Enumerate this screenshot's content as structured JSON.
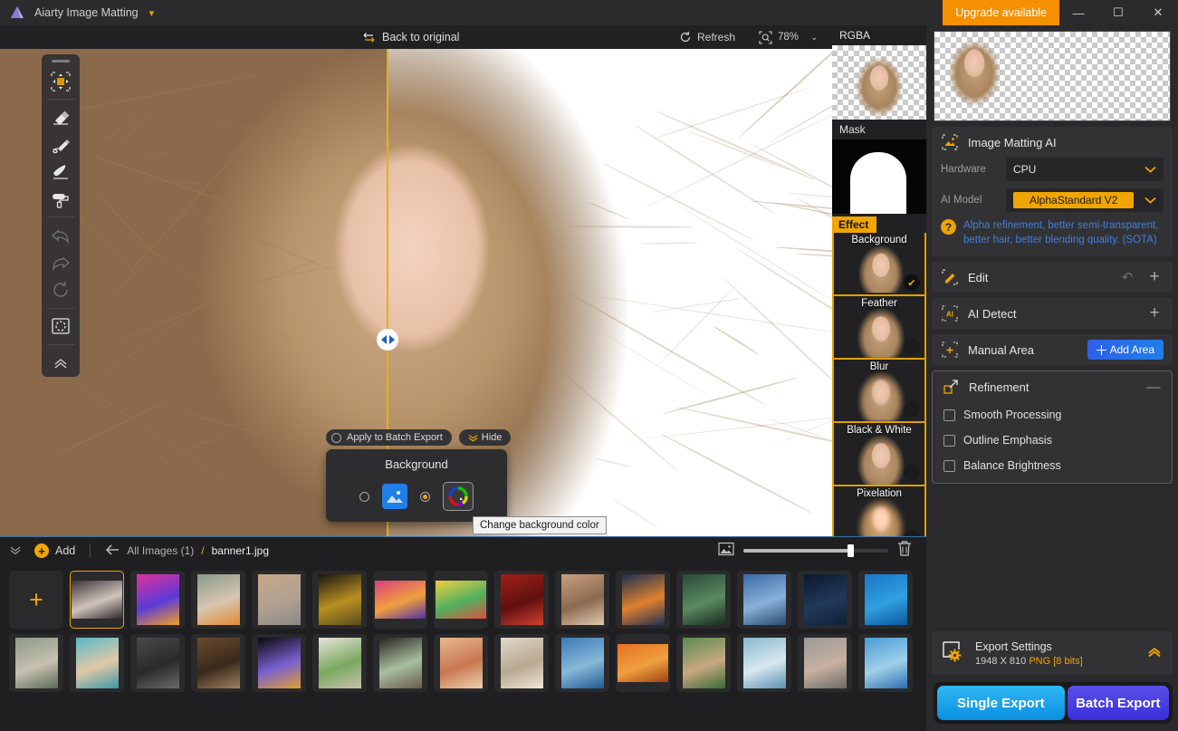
{
  "titlebar": {
    "app_name": "Aiarty Image Matting",
    "caret_icon": "chevron-down-icon",
    "upgrade_label": "Upgrade available",
    "minimize": "—",
    "maximize": "☐",
    "close": "✕"
  },
  "toolbar": {
    "back_to_original": "Back to original",
    "refresh": "Refresh",
    "zoom_level": "78%",
    "zoom_caret": "⌄"
  },
  "tools": [
    {
      "name": "move-tool",
      "glyph": "✥",
      "active": true,
      "dim": false
    },
    {
      "name": "eraser-tool",
      "glyph": "▱",
      "active": false,
      "dim": false
    },
    {
      "name": "pen-tool",
      "glyph": "✎",
      "active": false,
      "dim": false
    },
    {
      "name": "brush-tool",
      "glyph": "✒",
      "active": false,
      "dim": false
    },
    {
      "name": "roller-tool",
      "glyph": "▬",
      "active": false,
      "dim": false
    },
    {
      "name": "undo-tool",
      "glyph": "↶",
      "active": false,
      "dim": true
    },
    {
      "name": "redo-tool",
      "glyph": "↷",
      "active": false,
      "dim": true
    },
    {
      "name": "reset-tool",
      "glyph": "↺",
      "active": false,
      "dim": true
    },
    {
      "name": "selection-tool",
      "glyph": "◌",
      "active": false,
      "dim": false
    },
    {
      "name": "collapse-rail",
      "glyph": "⌃",
      "active": false,
      "dim": false
    }
  ],
  "background_popup": {
    "apply_batch_label": "Apply to Batch Export",
    "hide_label": "Hide",
    "hide_icon": "chevron-double-down-icon",
    "card_title": "Background",
    "option_image": "image-swatch",
    "option_color": "color-wheel-swatch",
    "selected": "color",
    "tooltip": "Change background color"
  },
  "strip": {
    "rgba_label": "RGBA",
    "mask_label": "Mask",
    "effect_label": "Effect",
    "effects": [
      {
        "name": "Background",
        "selected": true
      },
      {
        "name": "Feather",
        "selected": false
      },
      {
        "name": "Blur",
        "selected": false
      },
      {
        "name": "Black & White",
        "selected": false
      },
      {
        "name": "Pixelation",
        "selected": false
      }
    ],
    "check_glyph": "✔"
  },
  "right_panel": {
    "matting": {
      "icon": "image-matting-icon",
      "title": "Image Matting AI",
      "hardware_label": "Hardware",
      "hardware_value": "CPU",
      "ai_model_label": "AI Model",
      "ai_model_value": "AlphaStandard  V2",
      "note": "Alpha refinement, better semi-transparent, better hair, better blending quality. (SOTA)",
      "note_color": "#3f7fe0",
      "help_glyph": "?"
    },
    "edit": {
      "icon": "edit-pencil-icon",
      "title": "Edit",
      "undo_glyph": "↶",
      "add_glyph": "+"
    },
    "ai_detect": {
      "icon": "ai-detect-icon",
      "title": "AI Detect",
      "add_glyph": "+"
    },
    "manual_area": {
      "icon": "manual-area-icon",
      "title": "Manual Area",
      "button_label": "Add Area",
      "button_icon": "crosshair-icon"
    },
    "refinement": {
      "icon": "refinement-icon",
      "title": "Refinement",
      "collapse_glyph": "—",
      "options": [
        {
          "label": "Smooth Processing",
          "checked": false
        },
        {
          "label": "Outline Emphasis",
          "checked": false
        },
        {
          "label": "Balance Brightness",
          "checked": false
        }
      ]
    },
    "export_settings": {
      "icon": "export-settings-icon",
      "title": "Export Settings",
      "dimensions": "1948 X 810",
      "format": "PNG",
      "bitdepth": "[8 bits]",
      "chevron": "⌃"
    },
    "single_export": "Single Export",
    "batch_export": "Batch Export"
  },
  "bottombar": {
    "collapse_glyph": "⌄",
    "add_label": "Add",
    "add_glyph": "+",
    "back_glyph": "←",
    "all_images": "All Images (1)",
    "slash": "/",
    "current_file": "banner1.jpg",
    "thumb_size_icon": "image-size-icon",
    "trash_icon": "trash-icon"
  },
  "filmstrip": {
    "add_glyph": "+",
    "row1": [
      {
        "name": "thumb-portrait-1",
        "selected": true,
        "colors": [
          "#3a3537",
          "#cfc4bb",
          "#2f2a2c"
        ],
        "wide": true
      },
      {
        "name": "thumb-abstract-pink",
        "selected": false,
        "colors": [
          "#e0329a",
          "#5b3ad8",
          "#f0a020"
        ],
        "wide": false
      },
      {
        "name": "thumb-flower-crown",
        "selected": false,
        "colors": [
          "#8a9a8a",
          "#d8c5b0",
          "#e08a30"
        ],
        "wide": false
      },
      {
        "name": "thumb-street",
        "selected": false,
        "colors": [
          "#c8a88a",
          "#b0a090",
          "#8a8a88"
        ],
        "wide": false
      },
      {
        "name": "thumb-dark-yellow",
        "selected": false,
        "colors": [
          "#1a1612",
          "#b89020",
          "#5a4a20"
        ],
        "wide": false
      },
      {
        "name": "thumb-car-sunset",
        "selected": false,
        "colors": [
          "#d8407a",
          "#f0a040",
          "#5030a0"
        ],
        "wide": true
      },
      {
        "name": "thumb-color-fan",
        "selected": false,
        "colors": [
          "#f0d040",
          "#50b060",
          "#e05040"
        ],
        "wide": true
      },
      {
        "name": "thumb-red-figure",
        "selected": false,
        "colors": [
          "#a02018",
          "#601010",
          "#d04030"
        ],
        "wide": false
      },
      {
        "name": "thumb-blonde-woman",
        "selected": false,
        "colors": [
          "#c8a080",
          "#8a6a50",
          "#e0c8b0"
        ],
        "wide": false
      },
      {
        "name": "thumb-city-night",
        "selected": false,
        "colors": [
          "#1a3050",
          "#e08030",
          "#203050"
        ],
        "wide": false
      },
      {
        "name": "thumb-man-green",
        "selected": false,
        "colors": [
          "#2a4a38",
          "#5a8a60",
          "#1a2a20"
        ],
        "wide": false
      },
      {
        "name": "thumb-jump-blue",
        "selected": false,
        "colors": [
          "#3a6aa8",
          "#88b0d8",
          "#2a4a70"
        ],
        "wide": false
      },
      {
        "name": "thumb-night-sky",
        "selected": false,
        "colors": [
          "#0a1830",
          "#203a58",
          "#102038"
        ],
        "wide": false
      },
      {
        "name": "thumb-glasses-blue",
        "selected": false,
        "colors": [
          "#1878c8",
          "#30a0e0",
          "#0a58a0"
        ],
        "wide": false
      }
    ],
    "row2": [
      {
        "name": "thumb-lake-woman",
        "selected": false,
        "colors": [
          "#8a9a88",
          "#c8c0b0",
          "#5a6a58"
        ],
        "wide": false
      },
      {
        "name": "thumb-teal-portrait",
        "selected": false,
        "colors": [
          "#5ab8c8",
          "#e0c8a8",
          "#3a98a8"
        ],
        "wide": false
      },
      {
        "name": "thumb-man-bw",
        "selected": false,
        "colors": [
          "#4a4a4c",
          "#2a2a2c",
          "#6a6a6c"
        ],
        "wide": false
      },
      {
        "name": "thumb-warm-figure",
        "selected": false,
        "colors": [
          "#6a4a30",
          "#3a2a1a",
          "#a08060"
        ],
        "wide": false
      },
      {
        "name": "thumb-purple-flower",
        "selected": false,
        "colors": [
          "#0a0a0c",
          "#7a60d0",
          "#e0a030"
        ],
        "wide": false
      },
      {
        "name": "thumb-street-white",
        "selected": false,
        "colors": [
          "#e8e4dc",
          "#7aa860",
          "#c8c0b0"
        ],
        "wide": false
      },
      {
        "name": "thumb-curly-hair",
        "selected": false,
        "colors": [
          "#2a2420",
          "#a8c0a0",
          "#6a5a4a"
        ],
        "wide": false
      },
      {
        "name": "thumb-eye-closeup",
        "selected": false,
        "colors": [
          "#e8b890",
          "#c87850",
          "#f0d0b0"
        ],
        "wide": false
      },
      {
        "name": "thumb-bride",
        "selected": false,
        "colors": [
          "#e0d8c8",
          "#b8a890",
          "#f0e8d8"
        ],
        "wide": false
      },
      {
        "name": "thumb-swimmer",
        "selected": false,
        "colors": [
          "#3a7ab8",
          "#88b8d8",
          "#205a90"
        ],
        "wide": false
      },
      {
        "name": "thumb-orange-sunset",
        "selected": false,
        "colors": [
          "#e87020",
          "#f0a040",
          "#a04010"
        ],
        "wide": true
      },
      {
        "name": "thumb-hands-green",
        "selected": false,
        "colors": [
          "#5a8a50",
          "#c8a880",
          "#3a6a38"
        ],
        "wide": false
      },
      {
        "name": "thumb-water-splash",
        "selected": false,
        "colors": [
          "#88b8d0",
          "#d8e8f0",
          "#5a90b0"
        ],
        "wide": false
      },
      {
        "name": "thumb-woman-gray",
        "selected": false,
        "colors": [
          "#9a9a98",
          "#c8b0a0",
          "#6a6a68"
        ],
        "wide": false
      },
      {
        "name": "thumb-sky-blue",
        "selected": false,
        "colors": [
          "#4a9ad8",
          "#a0d0e8",
          "#2a70b0"
        ],
        "wide": false
      }
    ]
  }
}
